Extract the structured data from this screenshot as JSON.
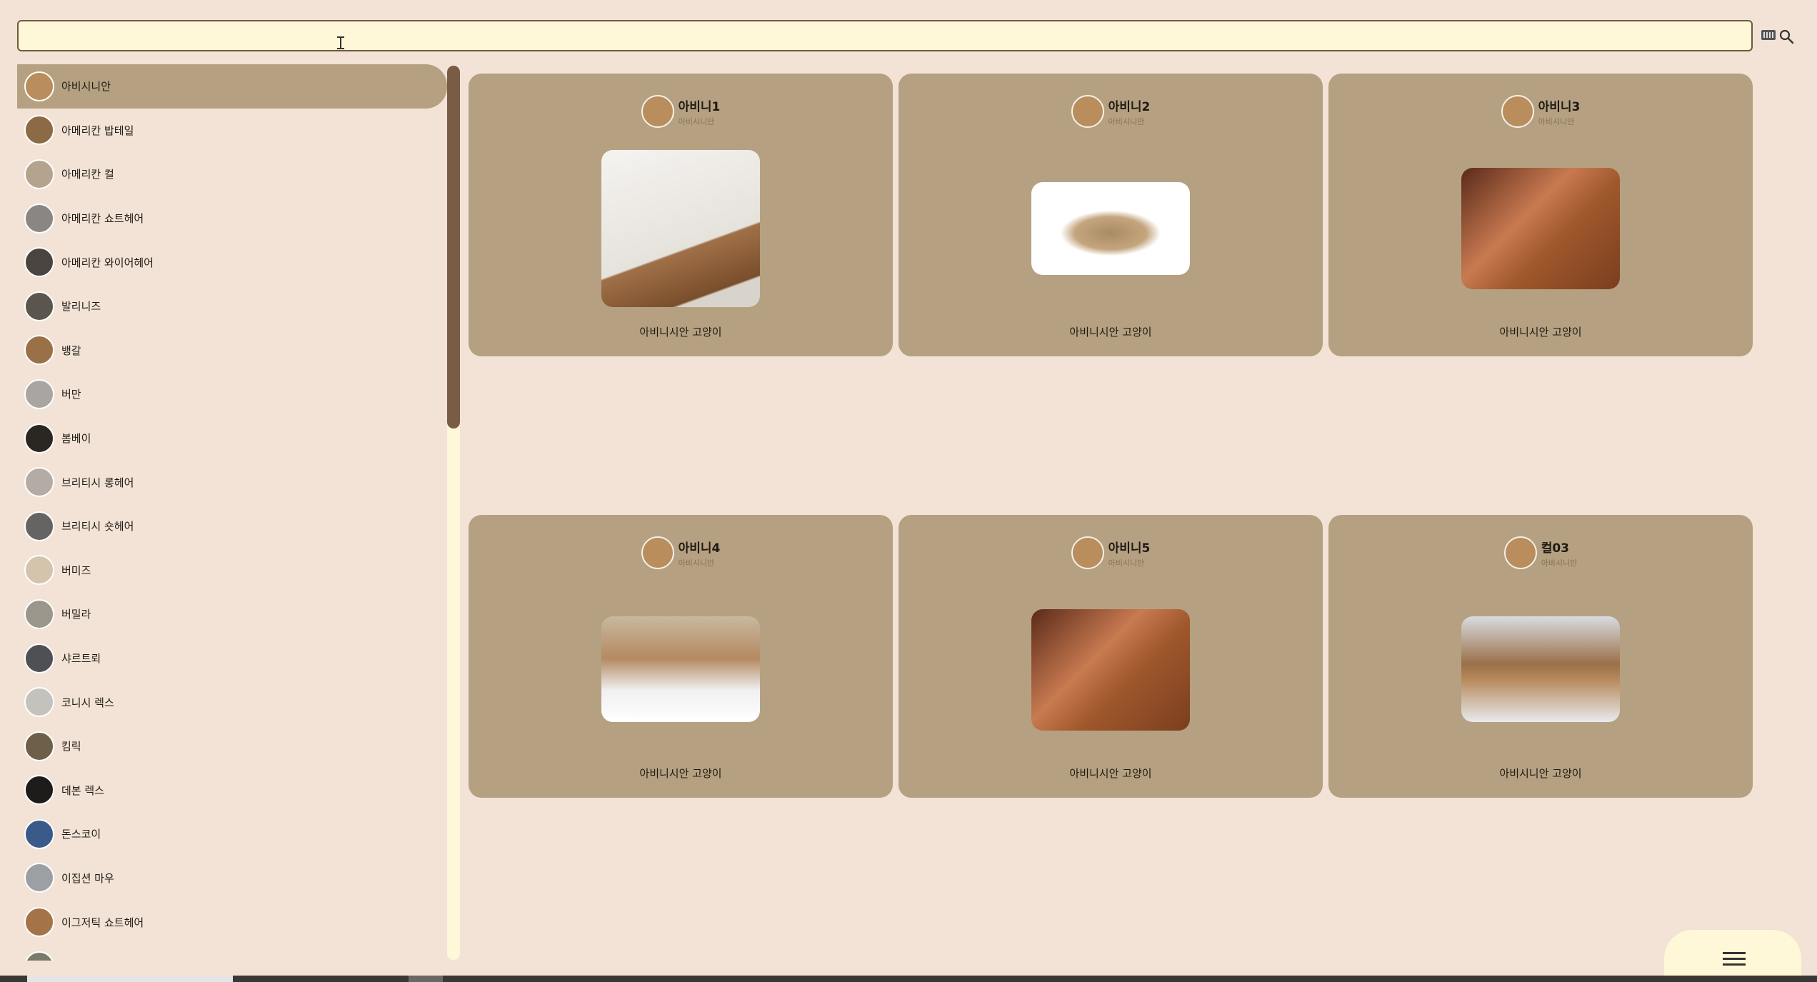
{
  "search": {
    "value": "",
    "placeholder": ""
  },
  "icons": {
    "keyboard": "keyboard-icon",
    "search": "search-icon",
    "menu": "hamburger-menu-icon"
  },
  "sidebar": {
    "items": [
      {
        "label": "아비시니안",
        "active": true,
        "color": "#b98d5c"
      },
      {
        "label": "아메리칸 밥테일",
        "color": "#8c6a45"
      },
      {
        "label": "아메리칸 컬",
        "color": "#b4a48e"
      },
      {
        "label": "아메리칸 쇼트헤어",
        "color": "#8a8683"
      },
      {
        "label": "아메리칸 와이어헤어",
        "color": "#4a4440"
      },
      {
        "label": "발리니즈",
        "color": "#5a564e"
      },
      {
        "label": "뱅갈",
        "color": "#9a7046"
      },
      {
        "label": "버만",
        "color": "#a8a5a2"
      },
      {
        "label": "봄베이",
        "color": "#2a2622"
      },
      {
        "label": "브리티시 롱헤어",
        "color": "#b4aca4"
      },
      {
        "label": "브리티시 숏헤어",
        "color": "#666462"
      },
      {
        "label": "버미즈",
        "color": "#d4c4ac"
      },
      {
        "label": "버밀라",
        "color": "#9a968c"
      },
      {
        "label": "샤르트뢰",
        "color": "#4e5054"
      },
      {
        "label": "코니시 렉스",
        "color": "#c4c2bc"
      },
      {
        "label": "킴릭",
        "color": "#6e6048"
      },
      {
        "label": "데본 렉스",
        "color": "#1e1c1a"
      },
      {
        "label": "돈스코이",
        "color": "#3a5a8a"
      },
      {
        "label": "이집션 마우",
        "color": "#9ca0a4"
      },
      {
        "label": "이그저틱 쇼트헤어",
        "color": "#a47448"
      },
      {
        "label": "",
        "color": "#7a7a6a"
      }
    ]
  },
  "cards": [
    {
      "title": "아비니1",
      "subtitle": "아비시니안",
      "caption": "아비니시안 고양이"
    },
    {
      "title": "아비니2",
      "subtitle": "아비시니안",
      "caption": "아비니시안 고양이"
    },
    {
      "title": "아비니3",
      "subtitle": "아비시니안",
      "caption": "아비니시안 고양이"
    },
    {
      "title": "아비니4",
      "subtitle": "아비시니안",
      "caption": "아비니시안 고양이"
    },
    {
      "title": "아비니5",
      "subtitle": "아비시니안",
      "caption": "아비니시안 고양이"
    },
    {
      "title": "컬03",
      "subtitle": "아비시니안",
      "caption": "아비시니안 고양이"
    }
  ],
  "colors": {
    "background": "#f2e3d6",
    "card": "#b5a181",
    "input": "#fff8d8",
    "scrollbar": "#7a5b45"
  }
}
